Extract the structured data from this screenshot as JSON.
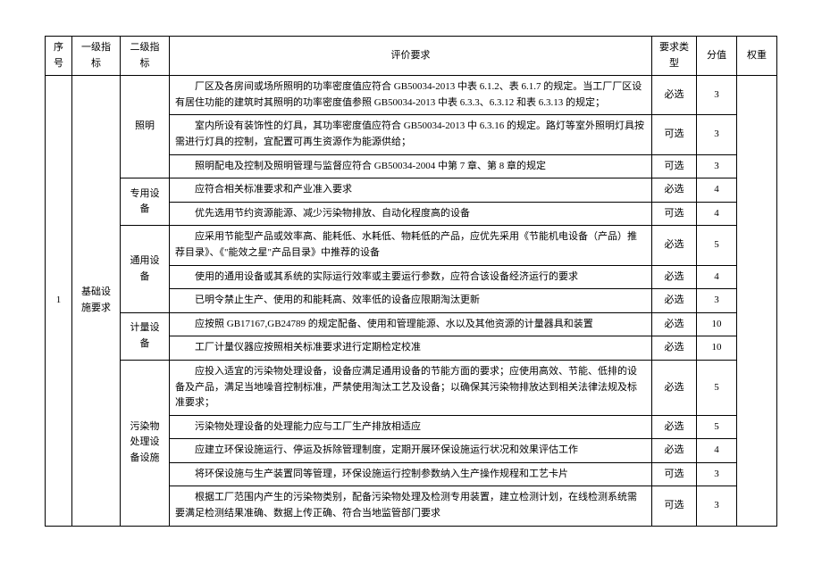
{
  "headers": {
    "seq": "序号",
    "level1": "一级指标",
    "level2": "二级指标",
    "req": "评价要求",
    "type": "要求类型",
    "score": "分值",
    "weight": "权重"
  },
  "seq": "1",
  "level1": "基础设施要求",
  "groups": [
    {
      "level2": "照明",
      "rows": [
        {
          "req": "厂区及各房间或场所照明的功率密度值应符合 GB50034-2013 中表 6.1.2、表 6.1.7 的规定。当工厂厂区设有居住功能的建筑时其照明的功率密度值参照 GB50034-2013 中表 6.3.3、6.3.12 和表 6.3.13 的规定；",
          "type": "必选",
          "score": "3"
        },
        {
          "req": "室内所设有装饰性的灯具，其功率密度值应符合 GB50034-2013 中 6.3.16 的规定。路灯等室外照明灯具按需进行灯具的控制，宜配置可再生资源作为能源供给；",
          "type": "可选",
          "score": "3"
        },
        {
          "req": "照明配电及控制及照明管理与监督应符合 GB50034-2004 中第 7 章、第 8 章的规定",
          "type": "可选",
          "score": "3"
        }
      ]
    },
    {
      "level2": "专用设备",
      "rows": [
        {
          "req": "应符合相关标准要求和产业准入要求",
          "type": "必选",
          "score": "4"
        },
        {
          "req": "优先选用节约资源能源、减少污染物排放、自动化程度高的设备",
          "type": "可选",
          "score": "4"
        }
      ]
    },
    {
      "level2": "通用设备",
      "rows": [
        {
          "req": "应采用节能型产品或效率高、能耗低、水耗低、物耗低的产品，应优先采用《节能机电设备（产品）推荐目录》、《\"能效之星\"产品目录》中推荐的设备",
          "type": "必选",
          "score": "5"
        },
        {
          "req": "使用的通用设备或其系统的实际运行效率或主要运行参数，应符合该设备经济运行的要求",
          "type": "必选",
          "score": "4"
        },
        {
          "req": "已明令禁止生产、使用的和能耗高、效率低的设备应限期淘汰更新",
          "type": "必选",
          "score": "3"
        }
      ]
    },
    {
      "level2": "计量设备",
      "rows": [
        {
          "req": "应按照 GB17167,GB24789 的规定配备、使用和管理能源、水以及其他资源的计量器具和装置",
          "type": "必选",
          "score": "10"
        },
        {
          "req": "工厂计量仪器应按照相关标准要求进行定期检定校准",
          "type": "必选",
          "score": "10"
        }
      ]
    },
    {
      "level2": "污染物处理设备设施",
      "rows": [
        {
          "req": "应投入适宜的污染物处理设备，设备应满足通用设备的节能方面的要求；应使用高效、节能、低排的设备及产品，满足当地噪音控制标准，严禁使用淘汰工艺及设备；以确保其污染物排放达到相关法律法规及标准要求；",
          "type": "必选",
          "score": "5"
        },
        {
          "req": "污染物处理设备的处理能力应与工厂生产排放相适应",
          "type": "必选",
          "score": "5"
        },
        {
          "req": "应建立环保设施运行、停运及拆除管理制度，定期开展环保设施运行状况和效果评估工作",
          "type": "必选",
          "score": "4"
        },
        {
          "req": "将环保设施与生产装置同等管理，环保设施运行控制参数纳入生产操作规程和工艺卡片",
          "type": "可选",
          "score": "3"
        },
        {
          "req": "根据工厂范围内产生的污染物类别，配备污染物处理及检测专用装置，建立检测计划，在线检测系统需要满足检测结果准确、数据上传正确、符合当地监管部门要求",
          "type": "可选",
          "score": "3"
        }
      ]
    }
  ]
}
